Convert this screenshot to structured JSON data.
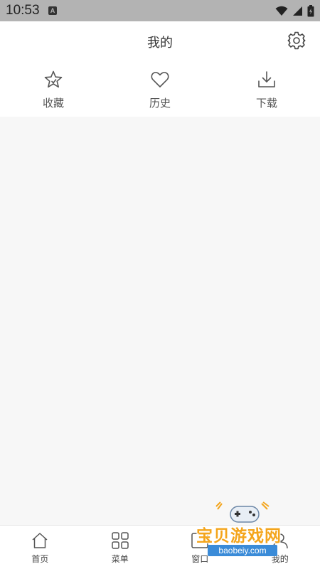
{
  "status_bar": {
    "time": "10:53",
    "notification_icon": "a-box-icon",
    "notification_glyph": "A",
    "icons": [
      "wifi-icon",
      "cell-signal-icon",
      "battery-icon"
    ]
  },
  "header": {
    "title": "我的",
    "settings_icon": "gear-icon"
  },
  "quick_actions": [
    {
      "label": "收藏",
      "icon": "star-icon"
    },
    {
      "label": "历史",
      "icon": "heart-icon"
    },
    {
      "label": "下载",
      "icon": "download-icon"
    }
  ],
  "bottom_nav": [
    {
      "label": "首页",
      "icon": "home-icon"
    },
    {
      "label": "菜单",
      "icon": "grid-icon"
    },
    {
      "label": "窗口",
      "icon": "window-icon"
    },
    {
      "label": "我的",
      "icon": "profile-icon"
    }
  ],
  "watermark": {
    "title": "宝贝游戏网",
    "url": "baobeiy.com"
  },
  "colors": {
    "status_bar_bg": "#b3b3b3",
    "page_bg": "#f7f7f7",
    "surface": "#ffffff",
    "text_primary": "#333333",
    "text_secondary": "#555555",
    "watermark_orange": "#f4a51c",
    "watermark_blue": "#3a8bd8"
  }
}
